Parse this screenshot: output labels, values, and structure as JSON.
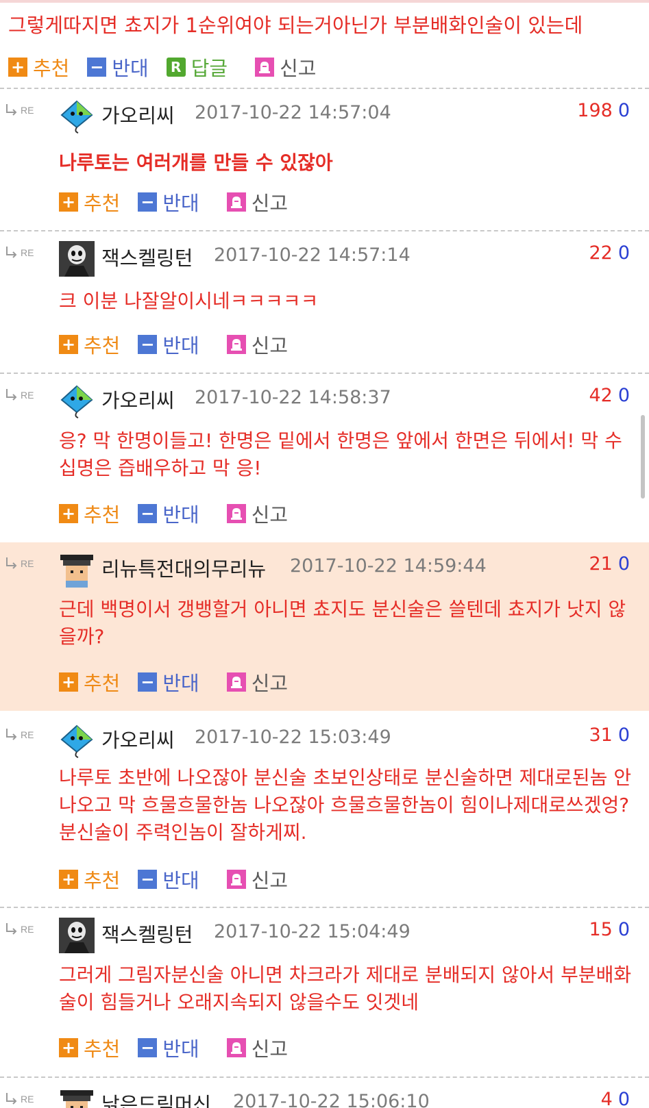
{
  "top_comment": {
    "text": "그렇게따지면 쵸지가 1순위여야 되는거아닌가 부분배화인술이 있는데",
    "actions": {
      "recommend": "추천",
      "oppose": "반대",
      "reply": "답글",
      "report": "신고"
    }
  },
  "action_labels": {
    "recommend": "추천",
    "oppose": "반대",
    "report": "신고"
  },
  "re_label": "RE",
  "comments": [
    {
      "nick": "가오리씨",
      "date": "2017-10-22 14:57:04",
      "up": "198",
      "down": "0",
      "text": "나루토는 여러개를 만들 수 있잖아",
      "avatar": "stingray-avatar-icon"
    },
    {
      "nick": "잭스켈링턴",
      "date": "2017-10-22 14:57:14",
      "up": "22",
      "down": "0",
      "text": "크 이분 나잘알이시네ㅋㅋㅋㅋㅋ",
      "avatar": "jack-skellington-avatar-icon"
    },
    {
      "nick": "가오리씨",
      "date": "2017-10-22 14:58:37",
      "up": "42",
      "down": "0",
      "text": "응? 막 한명이들고! 한명은 밑에서 한명은 앞에서 한면은 뒤에서! 막 수십명은 즙배우하고 막 응!",
      "avatar": "stingray-avatar-icon"
    },
    {
      "nick": "리뉴특전대의무리뉴",
      "date": "2017-10-22 14:59:44",
      "up": "21",
      "down": "0",
      "text": "근데 백명이서 갱뱅할거 아니면 쵸지도 분신술은 쓸텐데 쵸지가 낫지 않을까?",
      "avatar": "graduate-avatar-icon"
    },
    {
      "nick": "가오리씨",
      "date": "2017-10-22 15:03:49",
      "up": "31",
      "down": "0",
      "text": "나루토 초반에 나오잖아 분신술 초보인상태로 분신술하면 제대로된놈 안나오고 막 흐물흐물한놈 나오잖아 흐물흐물한놈이 힘이나제대로쓰겠엉? 분신술이 주력인놈이 잘하게찌.",
      "avatar": "stingray-avatar-icon"
    },
    {
      "nick": "잭스켈링턴",
      "date": "2017-10-22 15:04:49",
      "up": "15",
      "down": "0",
      "text": "그러게 그림자분신술 아니면 차크라가 제대로 분배되지 않아서 부분배화술이 힘들거나 오래지속되지 않을수도 잇겟네",
      "avatar": "jack-skellington-avatar-icon"
    },
    {
      "nick": "낡은드림머신",
      "date": "2017-10-22 15:06:10",
      "up": "4",
      "down": "0",
      "text": "",
      "avatar": "graduate-avatar-icon"
    }
  ],
  "colors": {
    "comment_text": "#e52d27",
    "upvote": "#e52d27",
    "downvote": "#2a3fd3",
    "recommend": "#ef8a16",
    "oppose": "#4a66c9",
    "reply": "#58a93a",
    "highlight_bg": "#fde6d6"
  }
}
